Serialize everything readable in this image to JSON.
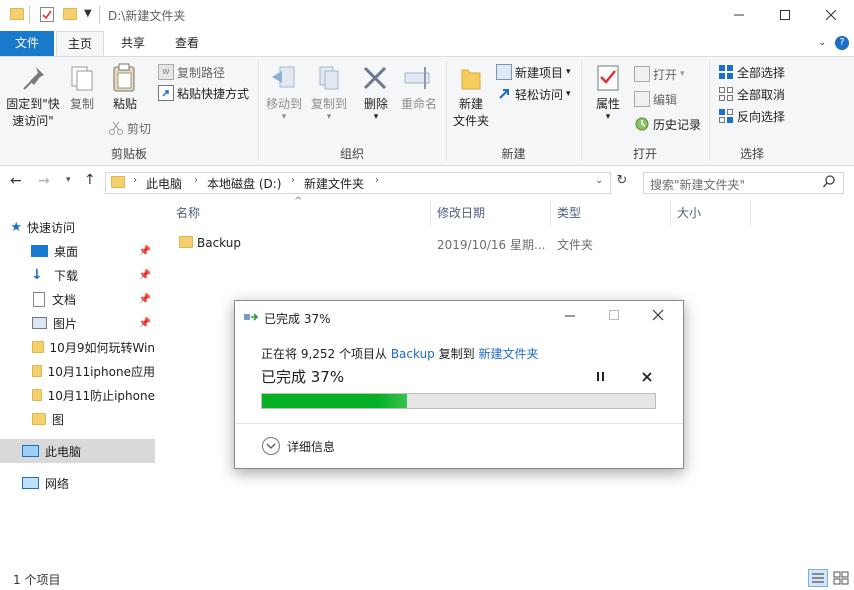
{
  "window": {
    "title": "D:\\新建文件夹"
  },
  "tabs": [
    "文件",
    "主页",
    "共享",
    "查看"
  ],
  "ribbon": {
    "clipboard": {
      "pin_label_1": "固定到\"快",
      "pin_label_2": "速访问\"",
      "copy_label": "复制",
      "paste_label": "粘贴",
      "copy_path": "复制路径",
      "paste_shortcut": "粘贴快捷方式",
      "cut": "剪切",
      "group": "剪贴板"
    },
    "organize": {
      "move_1": "移动到",
      "copy_1": "复制到",
      "delete": "删除",
      "rename": "重命名",
      "group": "组织"
    },
    "new": {
      "new_folder_1": "新建",
      "new_folder_2": "文件夹",
      "new_item": "新建项目",
      "easy_access": "轻松访问",
      "group": "新建"
    },
    "open": {
      "properties": "属性",
      "open": "打开",
      "edit": "编辑",
      "history": "历史记录",
      "group": "打开"
    },
    "select": {
      "select_all": "全部选择",
      "select_none": "全部取消",
      "invert": "反向选择",
      "group": "选择"
    }
  },
  "address": {
    "crumbs": [
      "此电脑",
      "本地磁盘 (D:)",
      "新建文件夹"
    ],
    "search_placeholder": "搜索\"新建文件夹\""
  },
  "nav": {
    "quick_access": "快速访问",
    "items": [
      {
        "label": "桌面",
        "pinned": true
      },
      {
        "label": "下载",
        "pinned": true
      },
      {
        "label": "文档",
        "pinned": true
      },
      {
        "label": "图片",
        "pinned": true
      },
      {
        "label": "10月9如何玩转Win"
      },
      {
        "label": "10月11iphone应用"
      },
      {
        "label": "10月11防止iphone"
      },
      {
        "label": "图"
      }
    ],
    "this_pc": "此电脑",
    "network": "网络"
  },
  "list": {
    "columns": [
      "名称",
      "修改日期",
      "类型",
      "大小"
    ],
    "rows": [
      {
        "name": "Backup",
        "date": "2019/10/16 星期...",
        "type": "文件夹",
        "size": ""
      }
    ]
  },
  "status": {
    "count": "1 个项目"
  },
  "dialog": {
    "title": "已完成 37%",
    "line_prefix": "正在将 9,252 个项目从 ",
    "source": "Backup",
    "line_mid": " 复制到 ",
    "dest": "新建文件夹",
    "progress_text": "已完成 37%",
    "progress": 0.37,
    "details": "详细信息",
    "link_color": "#1e6ac8",
    "progress_color": "#06b025"
  }
}
